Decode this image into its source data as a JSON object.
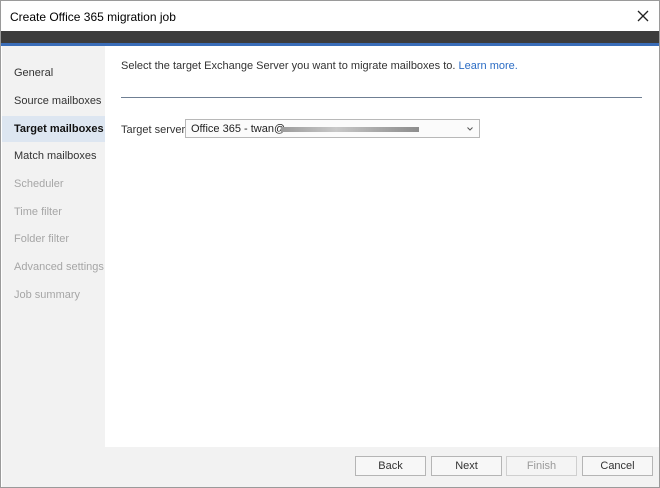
{
  "window": {
    "title": "Create Office 365 migration job"
  },
  "sidebar": {
    "items": [
      {
        "label": "General",
        "state": "normal"
      },
      {
        "label": "Source mailboxes",
        "state": "normal"
      },
      {
        "label": "Target mailboxes",
        "state": "active"
      },
      {
        "label": "Match mailboxes",
        "state": "normal"
      },
      {
        "label": "Scheduler",
        "state": "disabled"
      },
      {
        "label": "Time filter",
        "state": "disabled"
      },
      {
        "label": "Folder filter",
        "state": "disabled"
      },
      {
        "label": "Advanced settings",
        "state": "disabled"
      },
      {
        "label": "Job summary",
        "state": "disabled"
      }
    ]
  },
  "main": {
    "instruction": "Select the target Exchange Server you want to migrate mailboxes to.",
    "learn_more": "Learn more.",
    "target_label": "Target server:",
    "target_value": "Office 365 - twan@"
  },
  "footer": {
    "back": "Back",
    "next": "Next",
    "finish": "Finish",
    "cancel": "Cancel"
  },
  "colors": {
    "accent_bar": "#3a6db8",
    "header_band": "#3c3c3c",
    "active_nav": "#dde6f1",
    "link": "#2b6cc4"
  },
  "icons": {
    "close": "close-icon",
    "dropdown": "chevron-down-icon"
  }
}
